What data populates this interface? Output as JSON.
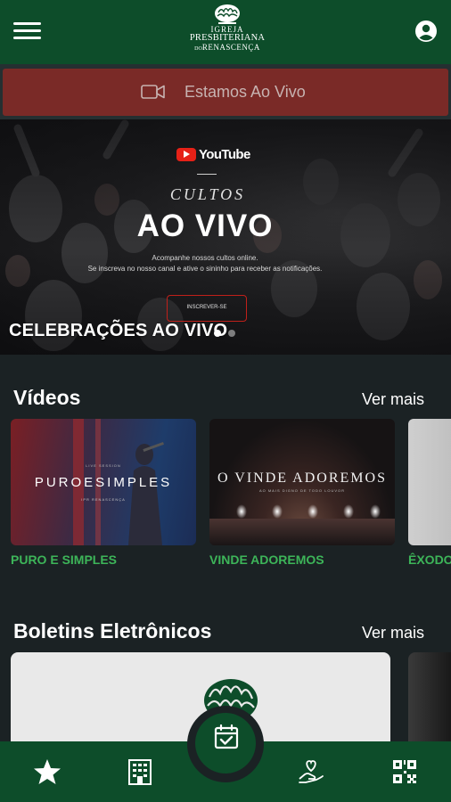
{
  "header": {
    "logo_line1": "IGREJA",
    "logo_line2": "PRESBITERIANA",
    "logo_line3_prefix": "DO",
    "logo_line3": "RENASCENÇA"
  },
  "live_banner": {
    "label": "Estamos Ao Vivo"
  },
  "hero": {
    "platform": "YouTube",
    "kicker": "CULTOS",
    "title": "AO VIVO",
    "subtitle_1": "Acompanhe nossos cultos online.",
    "subtitle_2": "Se inscreva no nosso canal e ative o sininho para receber as notificações.",
    "subscribe_label": "INSCREVER-SE",
    "caption": "CELEBRAÇÕES AO VIVO",
    "carousel_active_index": 0
  },
  "videos": {
    "title": "Vídeos",
    "more_label": "Ver mais",
    "items": [
      {
        "label": "PURO E SIMPLES",
        "thumb_top": "LIVE SESSION",
        "thumb_title": "PUROESIMPLES",
        "thumb_small": "IPR RENASCENÇA"
      },
      {
        "label": "VINDE ADOREMOS",
        "thumb_title": "O VINDE ADOREMOS",
        "thumb_small": "AO MAIS DIGNO DE TODO LOUVOR"
      },
      {
        "label": "ÊXODO"
      }
    ]
  },
  "bulletins": {
    "title": "Boletins Eletrônicos",
    "more_label": "Ver mais"
  },
  "colors": {
    "brand_green": "#0d4d2a",
    "label_green": "#3db559",
    "live_red": "#7a2a27",
    "background": "#1b2224"
  },
  "bottom_nav": {
    "items": [
      "star-icon",
      "building-icon",
      "calendar-check-icon",
      "hand-heart-icon",
      "qr-code-icon"
    ],
    "active": "calendar-check-icon"
  }
}
